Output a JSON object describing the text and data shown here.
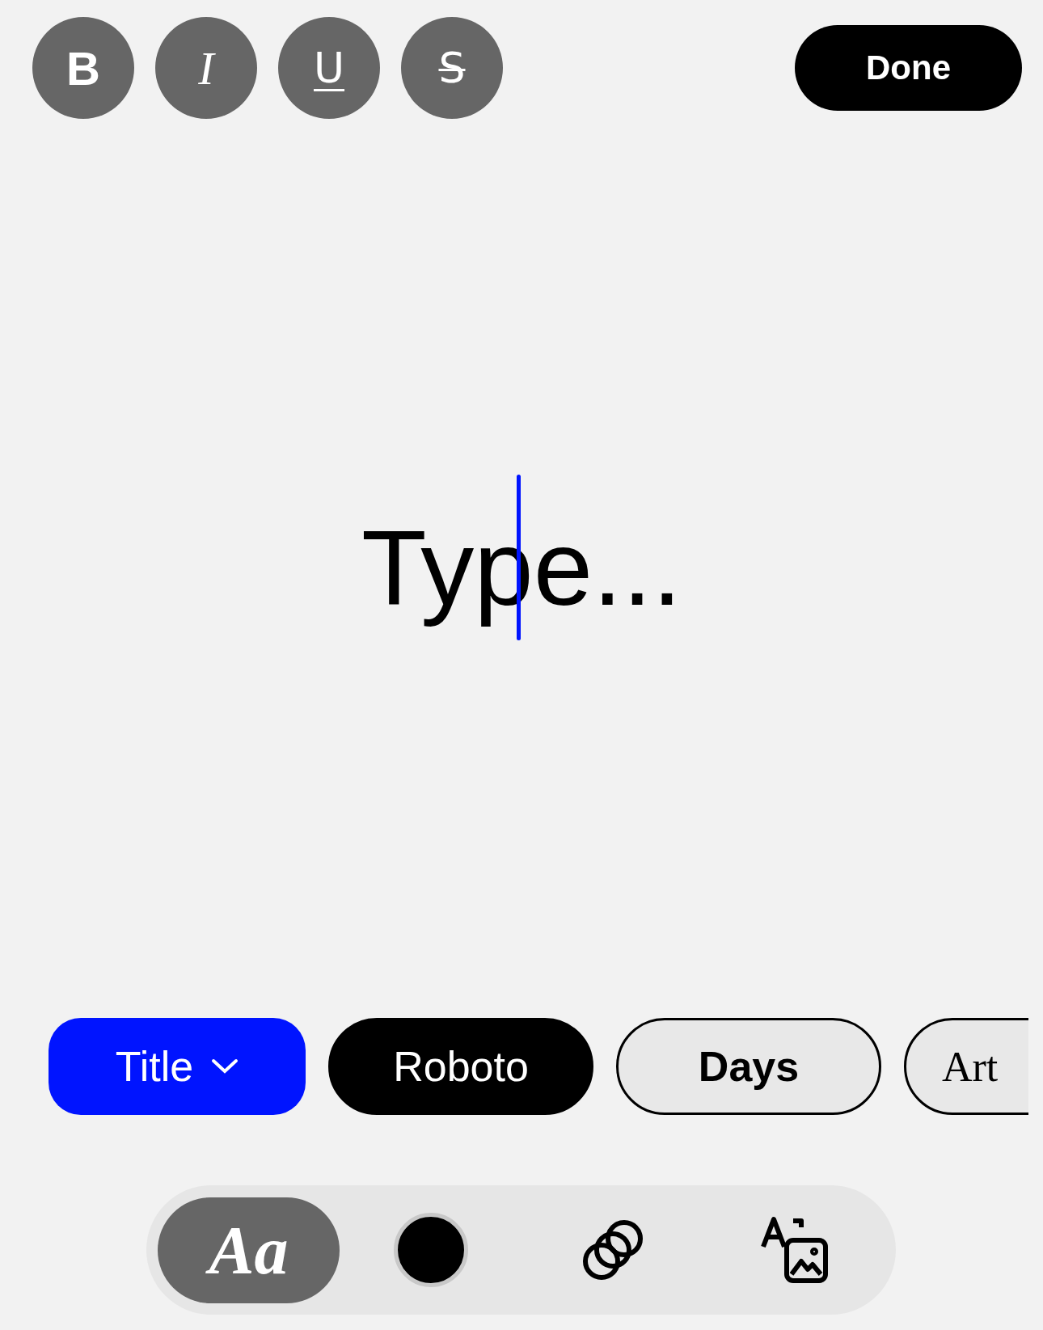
{
  "format_buttons": [
    {
      "kind": "bold",
      "label": "B"
    },
    {
      "kind": "italic",
      "label": "I"
    },
    {
      "kind": "underline",
      "label": "U"
    },
    {
      "kind": "strikethrough",
      "label": "S"
    }
  ],
  "done_button": {
    "label": "Done"
  },
  "editor": {
    "placeholder": "Type..."
  },
  "font_chips": [
    {
      "kind": "dropdown",
      "label": "Title"
    },
    {
      "kind": "font",
      "label": "Roboto",
      "selected": true
    },
    {
      "kind": "font",
      "label": "Days",
      "selected": false
    },
    {
      "kind": "font",
      "label": "Art",
      "selected": false
    }
  ],
  "tools": [
    {
      "kind": "text",
      "label": "Aa",
      "selected": true
    },
    {
      "kind": "color",
      "color": "#000000",
      "selected": false
    },
    {
      "kind": "effects",
      "selected": false
    },
    {
      "kind": "text-image",
      "selected": false
    }
  ]
}
